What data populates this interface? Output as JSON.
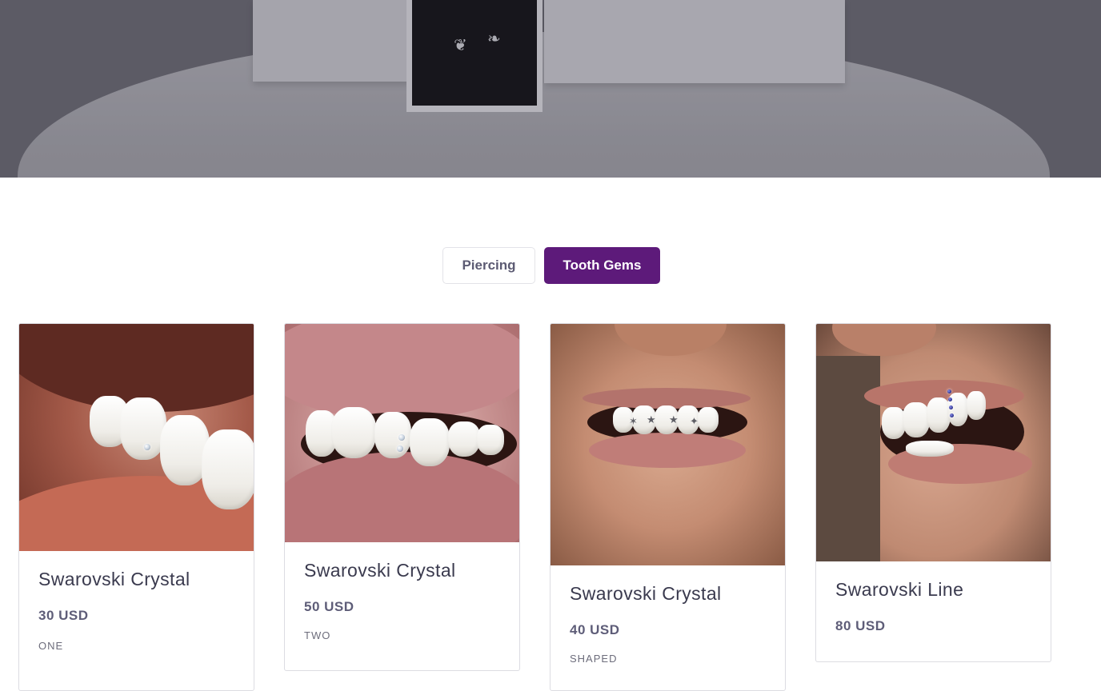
{
  "hero": {
    "earring_left_icon": "leaf-earring-icon",
    "earring_right_icon": "leaf-earring-icon"
  },
  "tabs": [
    {
      "label": "Piercing",
      "active": false
    },
    {
      "label": "Tooth Gems",
      "active": true
    }
  ],
  "colors": {
    "accent": "#5d1a7a",
    "text_dark": "#3a3a4e",
    "price": "#5e5d78"
  },
  "products": [
    {
      "title": "Swarovski Crystal",
      "price": "30 USD",
      "variant": "ONE"
    },
    {
      "title": "Swarovski Crystal",
      "price": "50 USD",
      "variant": "TWO"
    },
    {
      "title": "Swarovski Crystal",
      "price": "40 USD",
      "variant": "SHAPED"
    },
    {
      "title": "Swarovski Line",
      "price": "80 USD",
      "variant": ""
    }
  ]
}
